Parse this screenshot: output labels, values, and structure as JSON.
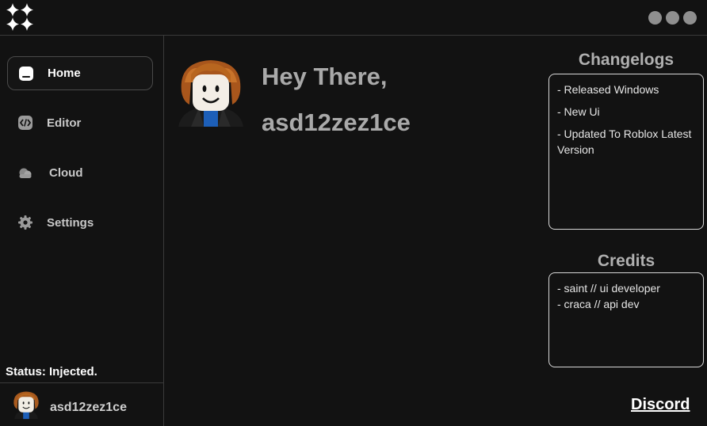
{
  "window": {
    "controls": [
      {
        "icon": "window-dot-icon"
      },
      {
        "icon": "window-dot-icon"
      },
      {
        "icon": "window-dot-icon"
      }
    ]
  },
  "logo": {
    "icon": "sparkle-logo-icon"
  },
  "sidebar": {
    "items": [
      {
        "label": "Home",
        "icon": "home-icon",
        "active": true
      },
      {
        "label": "Editor",
        "icon": "code-icon",
        "active": false
      },
      {
        "label": "Cloud",
        "icon": "cloud-icon",
        "active": false
      },
      {
        "label": "Settings",
        "icon": "gear-icon",
        "active": false
      }
    ],
    "status": "Status: Injected.",
    "username": "asd12zez1ce"
  },
  "main": {
    "greeting_line1": "Hey There,",
    "greeting_line2": "asd12zez1ce"
  },
  "changelogs": {
    "title": "Changelogs",
    "entries": [
      "- Released Windows",
      "- New Ui",
      "- Updated To Roblox Latest Version"
    ]
  },
  "credits": {
    "title": "Credits",
    "entries": [
      "- saint // ui developer",
      "- craca // api dev"
    ]
  },
  "discord_label": "Discord",
  "colors": {
    "background": "#121212",
    "divider": "#3a3a3a",
    "text_muted": "#a9a9a9",
    "window_dot": "#8f8f8f"
  }
}
